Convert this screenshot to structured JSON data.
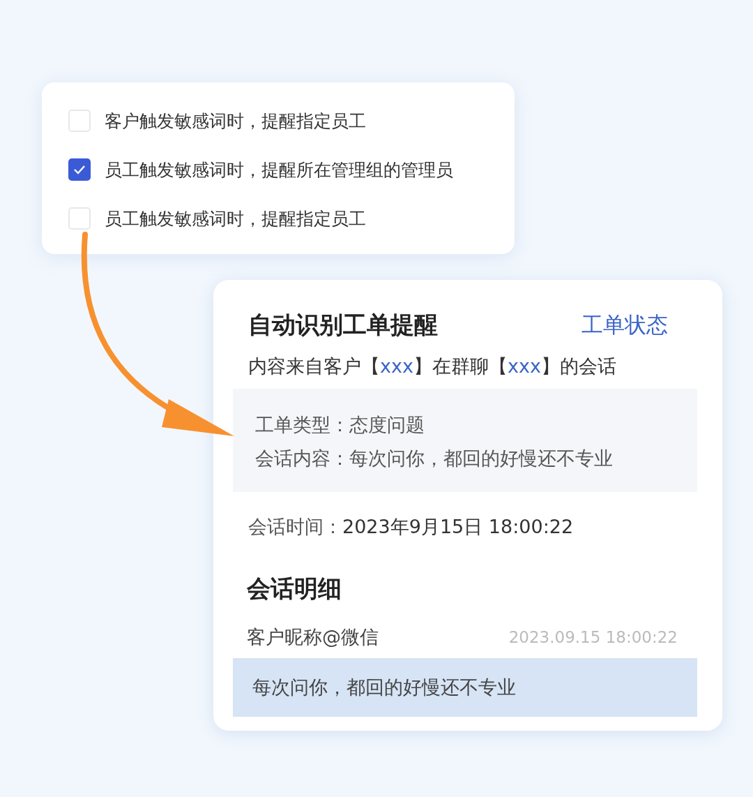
{
  "settings": {
    "options": [
      {
        "label": "客户触发敏感词时，提醒指定员工",
        "checked": false
      },
      {
        "label": "员工触发敏感词时，提醒所在管理组的管理员",
        "checked": true
      },
      {
        "label": "员工触发敏感词时，提醒指定员工",
        "checked": false
      }
    ]
  },
  "ticket_card": {
    "title": "自动识别工单提醒",
    "status_link": "工单状态",
    "source": [
      {
        "text": "内容来自客户【",
        "kind": "plain"
      },
      {
        "text": "xxx",
        "kind": "highlight"
      },
      {
        "text": "】在群聊【",
        "kind": "plain"
      },
      {
        "text": "xxx",
        "kind": "highlight"
      },
      {
        "text": "】的会话",
        "kind": "plain"
      }
    ],
    "details": [
      "工单类型：态度问题",
      "会话内容：每次问你，都回的好慢还不专业"
    ],
    "time_label": "会话时间：",
    "time_value": "2023年9月15日 18:00:22",
    "section_title": "会话明细",
    "message": {
      "sender": "客户昵称@微信",
      "timestamp": "2023.09.15 18:00:22",
      "text": "每次问你，都回的好慢还不专业"
    }
  }
}
